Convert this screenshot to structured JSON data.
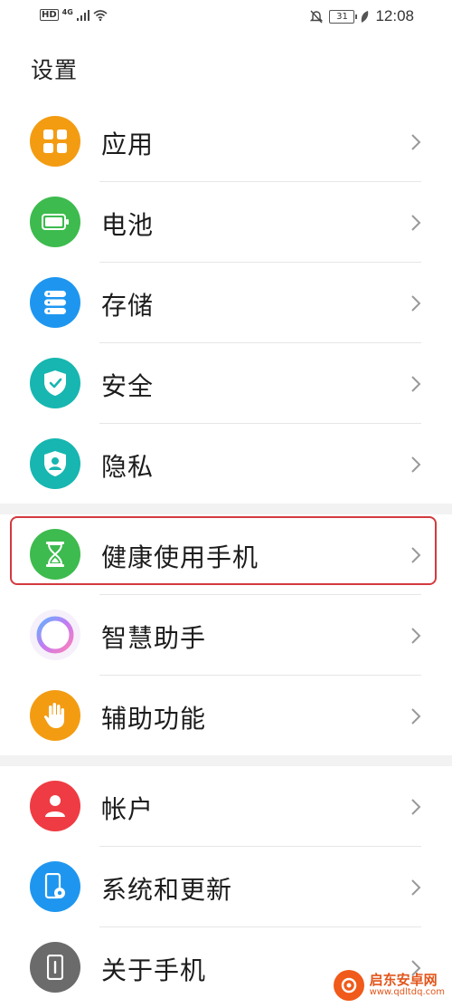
{
  "status_bar": {
    "hd": "HD",
    "network": "4G",
    "battery": "31",
    "time": "12:08"
  },
  "page": {
    "title": "设置"
  },
  "items": [
    {
      "label": "应用",
      "icon": "apps-grid-icon",
      "color": "#f39c12"
    },
    {
      "label": "电池",
      "icon": "battery-icon",
      "color": "#3dbb4e"
    },
    {
      "label": "存储",
      "icon": "storage-icon",
      "color": "#1e96f0"
    },
    {
      "label": "安全",
      "icon": "shield-check-icon",
      "color": "#17b6b0"
    },
    {
      "label": "隐私",
      "icon": "privacy-shield-icon",
      "color": "#17b6b0"
    },
    {
      "label": "健康使用手机",
      "icon": "hourglass-icon",
      "color": "#3dbb4e"
    },
    {
      "label": "智慧助手",
      "icon": "assistant-ring-icon",
      "color": "#b36cf0"
    },
    {
      "label": "辅助功能",
      "icon": "hand-icon",
      "color": "#f39c12"
    },
    {
      "label": "帐户",
      "icon": "account-icon",
      "color": "#ef3b43"
    },
    {
      "label": "系统和更新",
      "icon": "system-update-icon",
      "color": "#1e96f0"
    },
    {
      "label": "关于手机",
      "icon": "about-phone-icon",
      "color": "#6b6b6b"
    }
  ],
  "watermark": {
    "name": "启东安卓网",
    "url": "www.qdltdq.com"
  }
}
